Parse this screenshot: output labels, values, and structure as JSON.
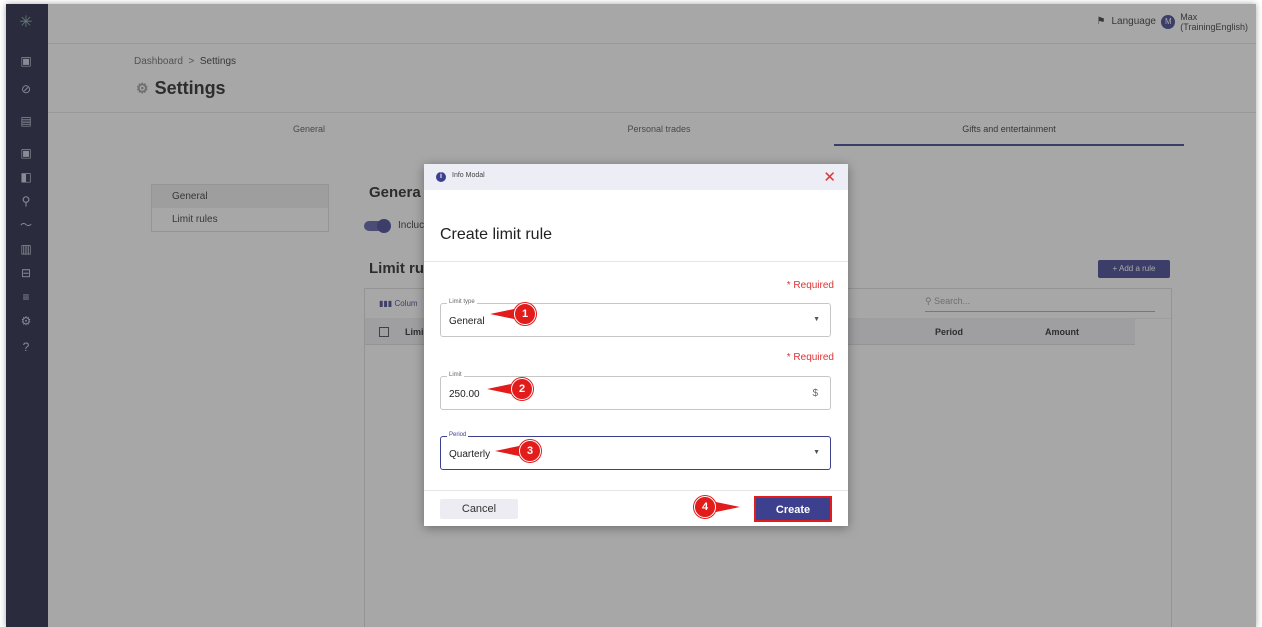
{
  "topbar": {
    "language_label": "Language",
    "user_initial": "M",
    "user_name": "Max",
    "user_org": "(TrainingEnglish)"
  },
  "breadcrumb": {
    "root": "Dashboard",
    "sep": ">",
    "current": "Settings"
  },
  "page_title": "Settings",
  "tabs": [
    {
      "label": "General"
    },
    {
      "label": "Personal trades"
    },
    {
      "label": "Gifts and entertainment"
    }
  ],
  "leftnav": {
    "items": [
      {
        "label": "General"
      },
      {
        "label": "Limit rules"
      }
    ]
  },
  "general_section": {
    "heading": "Genera",
    "toggle_label": "Incluc"
  },
  "limit_section": {
    "heading": "Limit ru",
    "add_rule": "+ Add a rule",
    "columns_btn": "Colum",
    "search_placeholder": "Search...",
    "headers": {
      "limit": "Limi",
      "period": "Period",
      "amount": "Amount"
    }
  },
  "modal": {
    "header_title": "Info Modal",
    "title": "Create limit rule",
    "required_1": "* Required",
    "required_2": "* Required",
    "limit_type": {
      "label": "Limit type",
      "value": "General"
    },
    "limit": {
      "label": "Limit",
      "value": "250.00",
      "suffix": "$"
    },
    "period": {
      "label": "Period",
      "value": "Quarterly"
    },
    "cancel": "Cancel",
    "create": "Create"
  },
  "callouts": [
    "1",
    "2",
    "3",
    "4"
  ],
  "colors": {
    "accent": "#3d3f8f",
    "highlight": "#e21b1b",
    "sidebar": "#1d1f3f"
  }
}
